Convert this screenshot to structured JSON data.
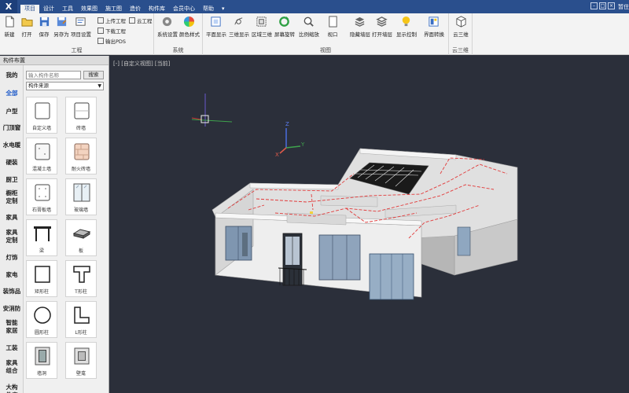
{
  "app": {
    "logo": "X",
    "corner": "暂住",
    "colors": {
      "titlebar": "#2a4f8d",
      "ribbon": "#f3f3f3",
      "viewport": "#2b2f3a",
      "accent": "#1a57c8"
    }
  },
  "menu": {
    "items": [
      {
        "label": "项目",
        "active": true
      },
      {
        "label": "设计"
      },
      {
        "label": "工具"
      },
      {
        "label": "效果图"
      },
      {
        "label": "施工图"
      },
      {
        "label": "造价"
      },
      {
        "label": "构件库"
      },
      {
        "label": "会员中心"
      },
      {
        "label": "帮助"
      },
      {
        "label": "▾"
      }
    ]
  },
  "ribbon": {
    "groups": [
      {
        "label": "工程",
        "buttons": [
          {
            "label": "新建",
            "icon": "new-file-icon"
          },
          {
            "label": "打开",
            "icon": "open-folder-icon"
          },
          {
            "label": "保存",
            "icon": "save-icon"
          },
          {
            "label": "另存为",
            "icon": "save-as-icon"
          },
          {
            "label": "项目设置",
            "icon": "project-settings-icon"
          }
        ],
        "small": [
          "上传工程",
          "下载工程",
          "输出PDS",
          "云工程"
        ]
      },
      {
        "label": "系统",
        "buttons": [
          {
            "label": "系统设置",
            "icon": "gear-icon"
          },
          {
            "label": "颜色样式",
            "icon": "color-wheel-icon"
          }
        ]
      },
      {
        "label": "视图",
        "buttons": [
          {
            "label": "平面显示",
            "icon": "plan-view-icon"
          },
          {
            "label": "三维显示",
            "icon": "3d-view-icon"
          },
          {
            "label": "区域三维",
            "icon": "region-3d-icon"
          },
          {
            "label": "屏幕旋转",
            "icon": "rotate-icon"
          },
          {
            "label": "比例缩放",
            "icon": "zoom-icon"
          },
          {
            "label": "视口",
            "icon": "viewport-icon"
          },
          {
            "label": "隐藏墙层",
            "icon": "layers-icon"
          },
          {
            "label": "打开墙层",
            "icon": "layers-open-icon"
          },
          {
            "label": "显示控制",
            "icon": "lightbulb-icon"
          },
          {
            "label": "界面转换",
            "icon": "interface-switch-icon"
          }
        ]
      },
      {
        "label": "云三维",
        "buttons": [
          {
            "label": "云三维",
            "icon": "cloud-3d-icon"
          }
        ]
      }
    ]
  },
  "panel": {
    "title": "构件布置",
    "categories": [
      "我的",
      "全部",
      "户型",
      "门顶窗",
      "水电暖",
      "硬装",
      "厨卫",
      "橱柜定制",
      "家具",
      "家具定制",
      "灯饰",
      "家电",
      "装饰品",
      "安消防",
      "智能家居",
      "工装",
      "家具组合",
      "大构件库"
    ],
    "active_category": "全部",
    "search": {
      "placeholder": "输入构件名称",
      "button": "搜索"
    },
    "source": "构件来源",
    "tiles": [
      {
        "label": "自定义墙",
        "icon": "custom-wall-icon"
      },
      {
        "label": "砖墙",
        "icon": "brick-wall-icon"
      },
      {
        "label": "混凝土墙",
        "icon": "concrete-wall-icon"
      },
      {
        "label": "耐火砖墙",
        "icon": "firebrick-wall-icon"
      },
      {
        "label": "石膏板墙",
        "icon": "gypsum-wall-icon"
      },
      {
        "label": "玻璃墙",
        "icon": "glass-wall-icon"
      },
      {
        "label": "梁",
        "icon": "beam-icon"
      },
      {
        "label": "板",
        "icon": "slab-icon"
      },
      {
        "label": "矩形柱",
        "icon": "rect-column-icon"
      },
      {
        "label": "T形柱",
        "icon": "t-column-icon"
      },
      {
        "label": "圆形柱",
        "icon": "round-column-icon"
      },
      {
        "label": "L形柱",
        "icon": "l-column-icon"
      },
      {
        "label": "墙洞",
        "icon": "wall-hole-icon"
      },
      {
        "label": "壁龛",
        "icon": "niche-icon"
      }
    ]
  },
  "viewport": {
    "label": "[-] [自定义视图] [当前]",
    "axes": {
      "x": "X",
      "y": "Y",
      "z": "Z"
    }
  }
}
